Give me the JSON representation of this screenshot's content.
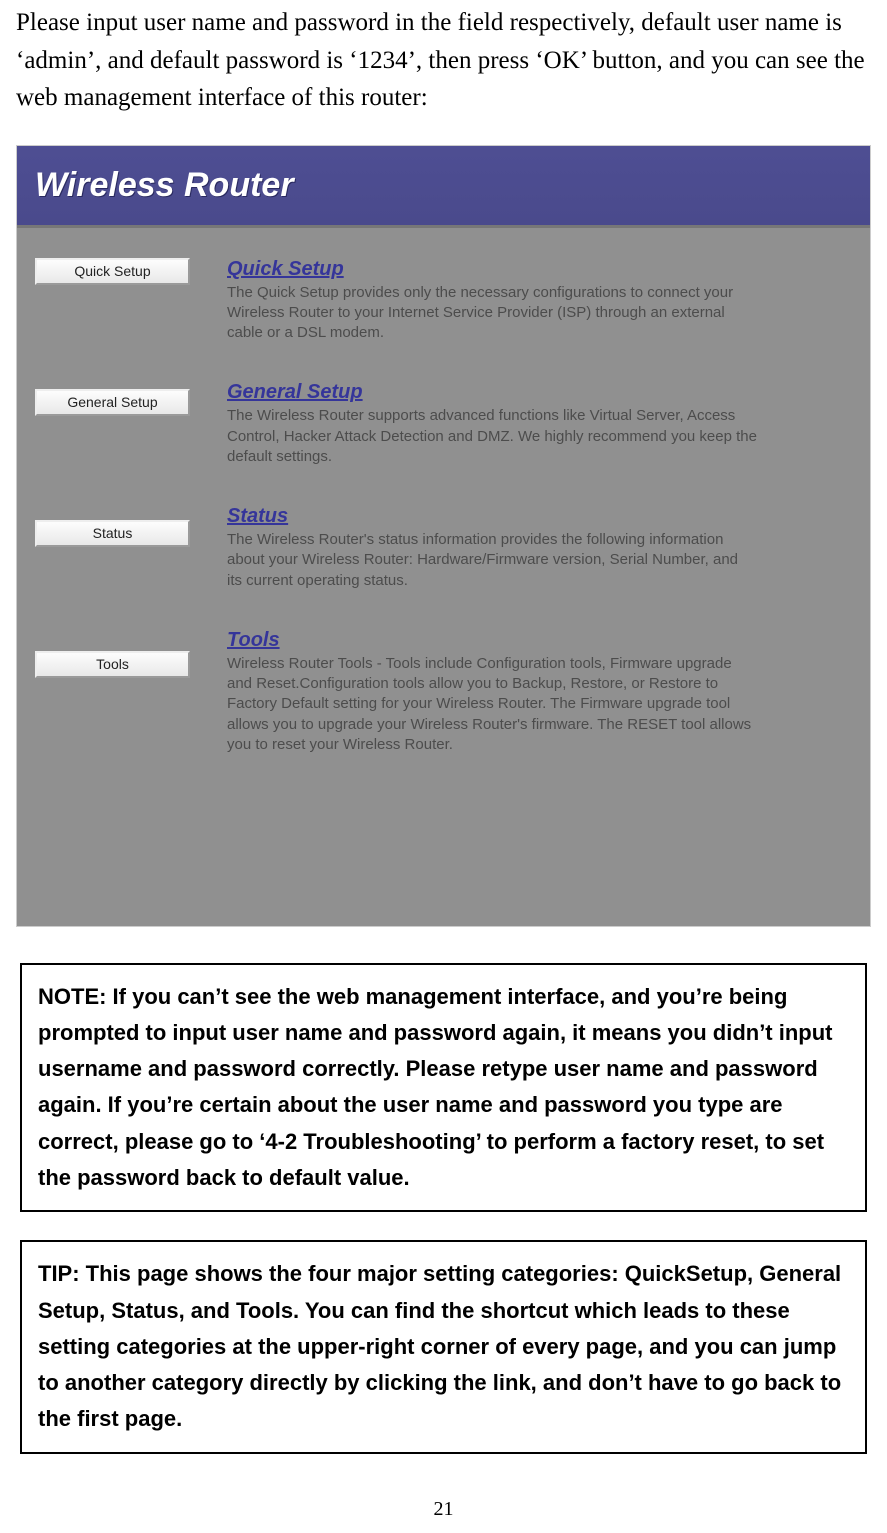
{
  "intro": "Please input user name and password in the field respectively, default user name is ‘admin’, and default password is ‘1234’, then press ‘OK’ button, and you can see the web management interface of this router:",
  "router": {
    "title": "Wireless Router",
    "sidebar": {
      "quick": "Quick Setup",
      "general": "General Setup",
      "status": "Status",
      "tools": "Tools"
    },
    "sections": {
      "quick": {
        "title": "Quick Setup",
        "desc": "The Quick Setup provides only the necessary configurations to connect your Wireless Router to your Internet Service Provider (ISP) through an external cable or a DSL modem."
      },
      "general": {
        "title": "General Setup",
        "desc": "The Wireless Router supports advanced functions like Virtual Server, Access Control, Hacker Attack Detection and DMZ. We highly recommend you keep the default settings."
      },
      "status": {
        "title": "Status",
        "desc": "The Wireless Router's status information provides the following information about your Wireless Router: Hardware/Firmware version, Serial Number, and its current operating status."
      },
      "tools": {
        "title": "Tools",
        "desc": "Wireless Router Tools - Tools include Configuration tools, Firmware upgrade and Reset.Configuration tools allow you to Backup, Restore, or Restore to Factory Default setting for your Wireless Router. The Firmware upgrade tool allows you to upgrade your Wireless Router's firmware. The RESET tool allows you to reset your Wireless Router."
      }
    }
  },
  "note": "NOTE: If you can’t see the web management interface, and you’re being prompted to input user name and password again, it means you didn’t input username and password correctly. Please retype user name and password again. If you’re certain about the user name and password you type are correct, please go to ‘4-2 Troubleshooting’ to perform a factory reset, to set the password back to default value.",
  "tip": "TIP: This page shows the four major setting categories: QuickSetup, General Setup, Status, and Tools. You can find the shortcut which leads to these setting categories at the upper-right corner of every page, and you can jump to another category directly by clicking the link, and don’t have to go back to the first page.",
  "page_number": "21"
}
